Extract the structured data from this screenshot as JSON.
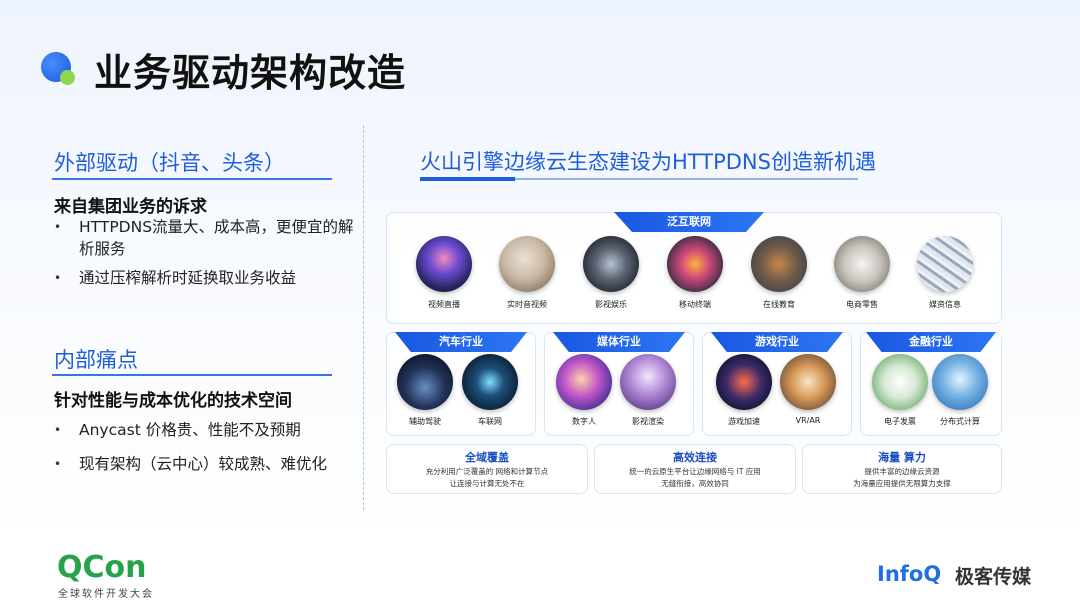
{
  "title": "业务驱动架构改造",
  "left": {
    "section1": {
      "title": "外部驱动（抖音、头条）",
      "subtitle": "来自集团业务的诉求",
      "bullets": [
        "HTTPDNS流量大、成本高，更便宜的解析服务",
        "通过压榨解析时延换取业务收益"
      ]
    },
    "section2": {
      "title": "内部痛点",
      "subtitle": "针对性能与成本优化的技术空间",
      "bullets": [
        "Anycast 价格贵、性能不及预期",
        "现有架构（云中心）较成熟、难优化"
      ]
    }
  },
  "right": {
    "title": "火山引擎边缘云生态建设为HTTPDNS创造新机遇",
    "top_panel": {
      "tab": "泛互联网",
      "items": [
        "视频直播",
        "实时音视频",
        "影视娱乐",
        "移动终端",
        "在线教育",
        "电商零售",
        "媒资信息"
      ]
    },
    "industries": [
      {
        "tab": "汽车行业",
        "items": [
          "辅助驾驶",
          "车联网"
        ]
      },
      {
        "tab": "媒体行业",
        "items": [
          "数字人",
          "影视渲染"
        ]
      },
      {
        "tab": "游戏行业",
        "items": [
          "游戏加速",
          "VR/AR"
        ]
      },
      {
        "tab": "金融行业",
        "items": [
          "电子发票",
          "分布式计算"
        ]
      }
    ],
    "features": [
      {
        "title": "全域覆盖",
        "desc1": "充分利用广泛覆盖的    网络和计算节点",
        "desc2": "让连接与计算无处不在"
      },
      {
        "title": "高效连接",
        "desc1": "统一的云原生平台让边缘网络与 IT 应用",
        "desc2": "无缝衔接，高效协同"
      },
      {
        "title": "海量 算力",
        "desc1": "提供丰富的边缘云资源",
        "desc2": "为海量应用提供无限算力支撑"
      }
    ]
  },
  "footer": {
    "qcon": "QCon",
    "qcon_sub": "全球软件开发大会",
    "infoq": "InfoQ",
    "geek": "极客传媒"
  },
  "colors": {
    "accent": "#1e5fd8",
    "qcon_green": "#26a34a"
  }
}
